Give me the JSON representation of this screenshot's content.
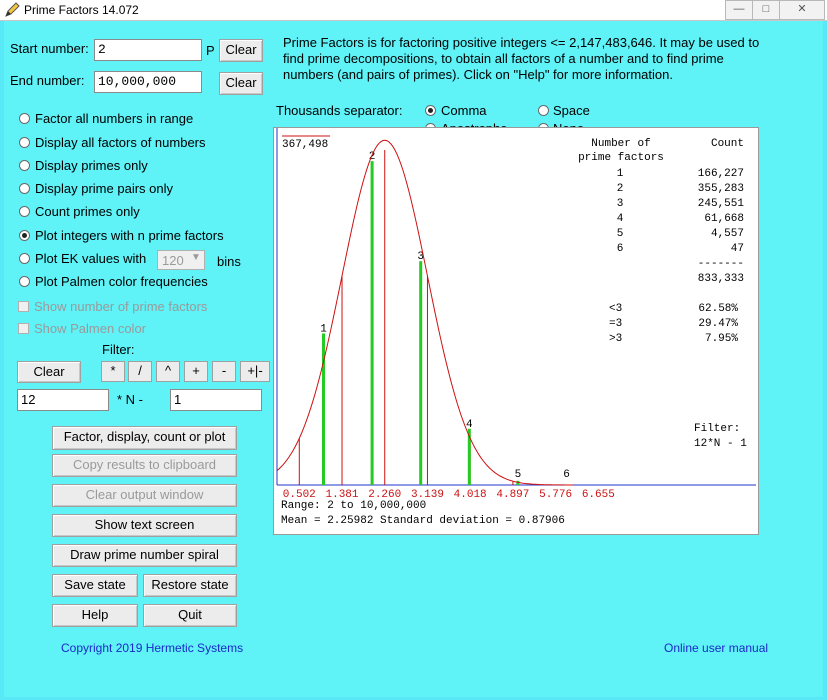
{
  "window": {
    "title": "Prime Factors 14.072",
    "min": "—",
    "max": "□",
    "close": "✕"
  },
  "start": {
    "label": "Start number:",
    "value": "2",
    "suffix": "P",
    "clear": "Clear"
  },
  "end": {
    "label": "End number:",
    "value": "10,000,000",
    "clear": "Clear"
  },
  "intro": "Prime Factors is for factoring positive integers <= 2,147,483,646.  It may be used to find prime decompositions, to obtain all factors of a number and to find prime numbers (and pairs of primes).  Click on \"Help\" for more information.",
  "separator": {
    "label": "Thousands separator:",
    "options": [
      "Comma",
      "Space",
      "Apostrophe",
      "None"
    ],
    "selected": "Comma"
  },
  "modes": [
    "Factor all numbers in range",
    "Display all factors of numbers",
    "Display primes only",
    "Display prime pairs only",
    "Count primes only",
    "Plot integers with n  prime factors",
    "Plot EK values with",
    "Plot Palmen color frequencies"
  ],
  "mode_selected": "Plot integers with n  prime factors",
  "ek": {
    "bins": "120",
    "bins_label": "bins"
  },
  "checks": [
    "Show number of prime factors",
    "Show Palmen color"
  ],
  "filter": {
    "label": "Filter:",
    "clear": "Clear",
    "ops": [
      "*",
      "/",
      "^",
      "+",
      "-",
      "+|-"
    ],
    "a": "12",
    "mid": "* N  -",
    "b": "1"
  },
  "buttons": {
    "factor": "Factor, display, count or plot",
    "copy": "Copy results to clipboard",
    "clear_output": "Clear output window",
    "text_screen": "Show text screen",
    "spiral": "Draw prime number spiral",
    "save": "Save state",
    "restore": "Restore state",
    "help": "Help",
    "quit": "Quit"
  },
  "footer": {
    "copyright": "Copyright 2019 Hermetic Systems",
    "manual": "Online user manual"
  },
  "colors": {
    "background": "#5ff2f7",
    "bar": "#22cc22",
    "curve": "#cc1111",
    "axis": "#2233cc"
  },
  "chart_data": {
    "type": "bar",
    "ymax_label": "367,498",
    "categories": [
      "1",
      "2",
      "3",
      "4",
      "5",
      "6"
    ],
    "values": [
      166227,
      355283,
      245551,
      61668,
      4557,
      47
    ],
    "ylim": [
      0,
      367498
    ],
    "x_ticks": [
      "0.502",
      "1.381",
      "2.260",
      "3.139",
      "4.018",
      "4.897",
      "5.776",
      "6.655"
    ],
    "table_header": [
      "Number of",
      "prime factors",
      "Count"
    ],
    "total": "833,333",
    "dashes": "-------",
    "counts_text": [
      "166,227",
      "355,283",
      "245,551",
      "61,668",
      "4,557",
      "47"
    ],
    "stats": [
      {
        "label": "<3",
        "value": "62.58%"
      },
      {
        "label": "=3",
        "value": "29.47%"
      },
      {
        "label": ">3",
        "value": "7.95%"
      }
    ],
    "filter_label": "Filter:",
    "filter_value": "12*N - 1",
    "range": "Range: 2 to 10,000,000",
    "mean": "Mean = 2.25982 Standard deviation = 0.87906"
  }
}
